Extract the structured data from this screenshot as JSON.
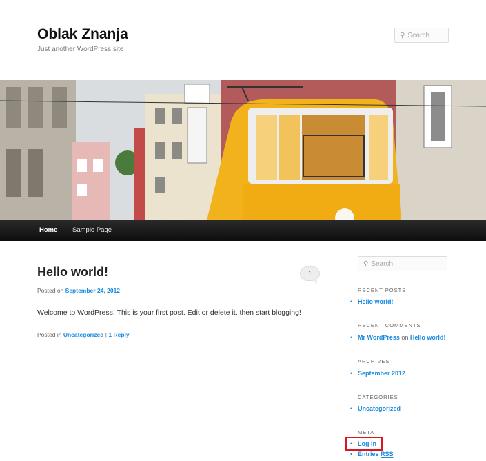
{
  "site": {
    "title": "Oblak Znanja",
    "description": "Just another WordPress site"
  },
  "header_search": {
    "placeholder": "Search"
  },
  "nav": {
    "items": [
      {
        "label": "Home"
      },
      {
        "label": "Sample Page"
      }
    ]
  },
  "post": {
    "title": "Hello world!",
    "comment_count": "1",
    "posted_on_label": "Posted on",
    "date": "September 24, 2012",
    "body": "Welcome to WordPress. This is your first post. Edit or delete it, then start blogging!",
    "posted_in_label": "Posted in",
    "category": "Uncategorized",
    "separator": "|",
    "reply_link": "1 Reply"
  },
  "sidebar": {
    "search_placeholder": "Search",
    "recent_posts": {
      "title": "RECENT POSTS",
      "items": [
        "Hello world!"
      ]
    },
    "recent_comments": {
      "title": "RECENT COMMENTS",
      "author": "Mr WordPress",
      "connector": "on",
      "post": "Hello world!"
    },
    "archives": {
      "title": "ARCHIVES",
      "items": [
        "September 2012"
      ]
    },
    "categories": {
      "title": "CATEGORIES",
      "items": [
        "Uncategorized"
      ]
    },
    "meta": {
      "title": "META",
      "login": "Log in",
      "entries": "Entries",
      "rss": "RSS"
    }
  },
  "colors": {
    "link": "#1b8be0",
    "nav_bg": "#111111",
    "highlight": "#e0141e",
    "tram": "#f2b21c"
  }
}
